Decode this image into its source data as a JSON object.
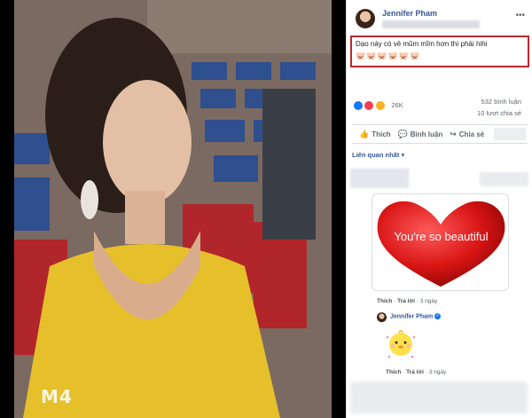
{
  "photo": {
    "watermark": "M4"
  },
  "post": {
    "author": "Jennifer Pham",
    "more_icon": "more-horizontal-icon",
    "status_text": "Dạo này có vẻ mũm mĩm hơn thì phải hihi",
    "emojis": "🐷🐷🐷🐷🐷🐷",
    "reactions": {
      "types": [
        "like",
        "love",
        "haha"
      ],
      "count": "26K"
    },
    "comments_count": "532 bình luận",
    "shares_count": "10 lượt chia sẻ",
    "actions": {
      "like": "Thích",
      "comment": "Bình luận",
      "share": "Chia sẻ"
    },
    "sort_label": "Liên quan nhất"
  },
  "comment": {
    "sticker_text": "You're so beautiful",
    "like": "Thích",
    "reply": "Trả lời",
    "time": "3 ngày"
  },
  "reply": {
    "author": "Jennifer Pham",
    "like": "Thích",
    "reply": "Trả lời",
    "time": "3 ngày"
  },
  "colors": {
    "link_blue": "#385898",
    "highlight_red": "#c0272d",
    "like_blue": "#1877f2",
    "love_red": "#f33e58",
    "haha_yellow": "#f7b125"
  }
}
